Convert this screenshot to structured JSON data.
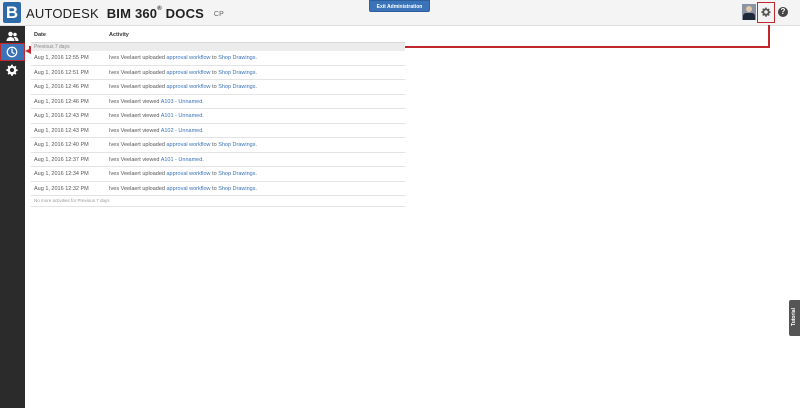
{
  "header": {
    "logo_letter": "B",
    "brand_company": "AUTODESK",
    "brand_product": "BIM 360",
    "brand_reg": "®",
    "brand_module": "DOCS",
    "project_code": "CP",
    "exit_button": "Exit Administration",
    "help_glyph": "?",
    "icons": [
      "user-avatar",
      "gear-icon",
      "help-icon"
    ]
  },
  "sidebar": {
    "items": [
      {
        "icon": "users-icon",
        "active": false
      },
      {
        "icon": "clock-icon",
        "active": true
      },
      {
        "icon": "gear-icon",
        "active": false
      }
    ]
  },
  "activity": {
    "columns": [
      "Date",
      "Activity"
    ],
    "group_label": "Previous 7 days",
    "rows": [
      {
        "date": "Aug 1, 2016 12:55 PM",
        "user": "Ives Veelaert",
        "verb": "uploaded",
        "object": "approval workflow",
        "prep": "to",
        "target": "Shop Drawings."
      },
      {
        "date": "Aug 1, 2016 12:51 PM",
        "user": "Ives Veelaert",
        "verb": "uploaded",
        "object": "approval workflow",
        "prep": "to",
        "target": "Shop Drawings."
      },
      {
        "date": "Aug 1, 2016 12:46 PM",
        "user": "Ives Veelaert",
        "verb": "uploaded",
        "object": "approval workflow",
        "prep": "to",
        "target": "Shop Drawings."
      },
      {
        "date": "Aug 1, 2016 12:46 PM",
        "user": "Ives Veelaert",
        "verb": "viewed",
        "object": "A103 - Unnamed.",
        "prep": "",
        "target": ""
      },
      {
        "date": "Aug 1, 2016 12:43 PM",
        "user": "Ives Veelaert",
        "verb": "viewed",
        "object": "A101 - Unnamed.",
        "prep": "",
        "target": ""
      },
      {
        "date": "Aug 1, 2016 12:43 PM",
        "user": "Ives Veelaert",
        "verb": "viewed",
        "object": "A102 - Unnamed.",
        "prep": "",
        "target": ""
      },
      {
        "date": "Aug 1, 2016 12:40 PM",
        "user": "Ives Veelaert",
        "verb": "uploaded",
        "object": "approval workflow",
        "prep": "to",
        "target": "Shop Drawings."
      },
      {
        "date": "Aug 1, 2016 12:37 PM",
        "user": "Ives Veelaert",
        "verb": "viewed",
        "object": "A101 - Unnamed.",
        "prep": "",
        "target": ""
      },
      {
        "date": "Aug 1, 2016 12:34 PM",
        "user": "Ives Veelaert",
        "verb": "uploaded",
        "object": "approval workflow",
        "prep": "to",
        "target": "Shop Drawings."
      },
      {
        "date": "Aug 1, 2016 12:32 PM",
        "user": "Ives Veelaert",
        "verb": "uploaded",
        "object": "approval workflow",
        "prep": "to",
        "target": "Shop Drawings."
      }
    ],
    "footer_note": "No more activities for Previous 7 days"
  },
  "tutorial_tab": "Tutorial",
  "colors": {
    "accent": "#3b73b9",
    "highlight": "#c0282e",
    "sidebar": "#2b2b2b"
  }
}
